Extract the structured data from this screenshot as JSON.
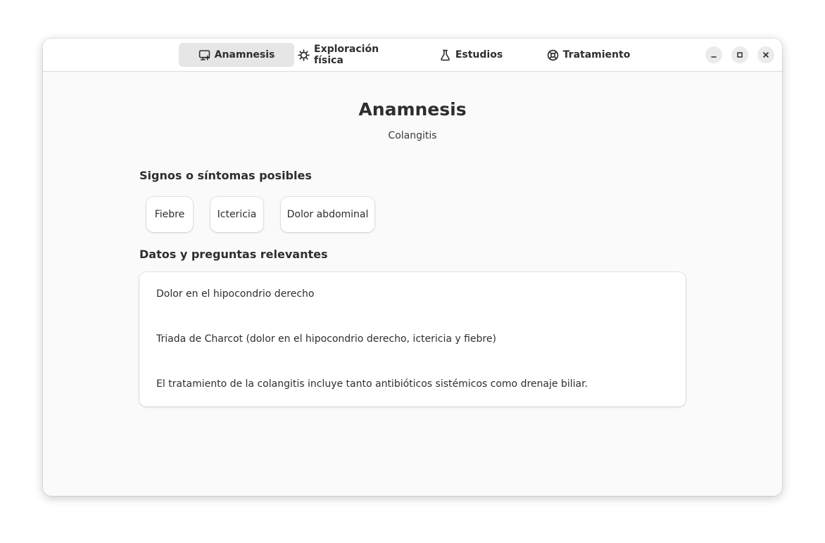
{
  "tabs": [
    {
      "label": "Anamnesis",
      "icon": "clipboard-icon"
    },
    {
      "label": "Exploración física",
      "icon": "gear-icon"
    },
    {
      "label": "Estudios",
      "icon": "flask-icon"
    },
    {
      "label": "Tratamiento",
      "icon": "lifebuoy-icon"
    }
  ],
  "window_controls": [
    "minimize",
    "maximize",
    "close"
  ],
  "page": {
    "title": "Anamnesis",
    "subtitle": "Colangitis"
  },
  "symptoms": {
    "heading": "Signos o síntomas posibles",
    "items": [
      "Fiebre",
      "Ictericia",
      "Dolor abdominal"
    ]
  },
  "relevant": {
    "heading": "Datos y preguntas relevantes",
    "items": [
      "Dolor en el hipocondrio derecho",
      "Triada de Charcot (dolor en el hipocondrio derecho, ictericia y fiebre)",
      "El tratamiento de la colangitis incluye tanto antibióticos sistémicos como drenaje biliar."
    ]
  }
}
